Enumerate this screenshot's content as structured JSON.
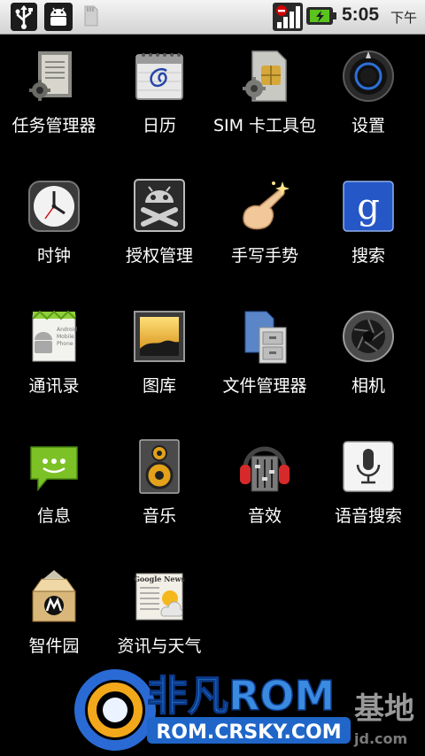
{
  "status_bar": {
    "time": "5:05",
    "ampm": "下午",
    "icons": [
      "usb-icon",
      "android-debug-icon",
      "sd-card-icon",
      "signal-icon",
      "battery-charging-icon"
    ]
  },
  "apps": [
    {
      "label": "任务管理器",
      "icon": "task-manager-icon"
    },
    {
      "label": "日历",
      "icon": "calendar-icon"
    },
    {
      "label": "SIM 卡工具包",
      "icon": "sim-toolkit-icon"
    },
    {
      "label": "设置",
      "icon": "settings-icon"
    },
    {
      "label": "时钟",
      "icon": "clock-icon"
    },
    {
      "label": "授权管理",
      "icon": "superuser-icon"
    },
    {
      "label": "手写手势",
      "icon": "gesture-icon"
    },
    {
      "label": "搜索",
      "icon": "google-search-icon"
    },
    {
      "label": "通讯录",
      "icon": "contacts-icon"
    },
    {
      "label": "图库",
      "icon": "gallery-icon"
    },
    {
      "label": "文件管理器",
      "icon": "file-manager-icon"
    },
    {
      "label": "相机",
      "icon": "camera-icon"
    },
    {
      "label": "信息",
      "icon": "messaging-icon"
    },
    {
      "label": "音乐",
      "icon": "music-icon"
    },
    {
      "label": "音效",
      "icon": "sound-effects-icon"
    },
    {
      "label": "语音搜索",
      "icon": "voice-search-icon"
    },
    {
      "label": "智件园",
      "icon": "motorola-app-market-icon"
    },
    {
      "label": "资讯与天气",
      "icon": "news-weather-icon"
    }
  ],
  "watermark": {
    "brand": "非凡ROM",
    "url": "ROM.CRSKY.COM",
    "suffix": "基地",
    "site": "jd.com"
  },
  "colors": {
    "background": "#000000",
    "statusbar": "#e6e6e6",
    "rom_green": "#7dd321",
    "watermark_blue": "#1f66c8"
  }
}
